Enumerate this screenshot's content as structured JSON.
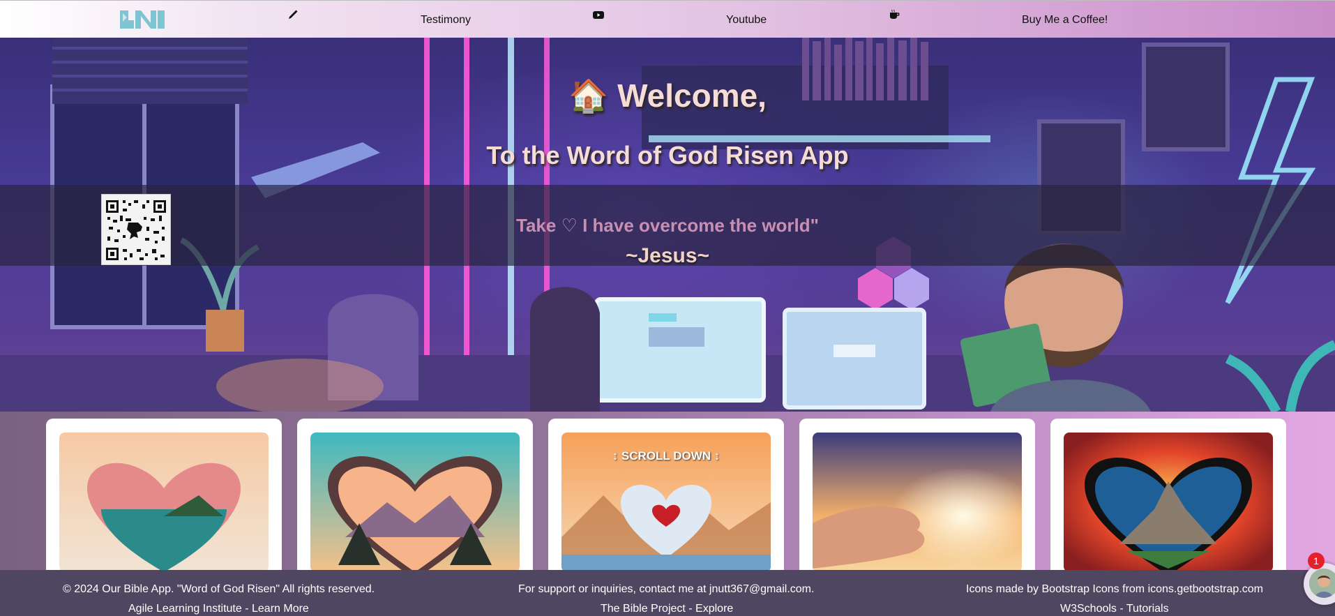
{
  "nav": {
    "logo_text": "JN",
    "items": [
      {
        "icon": "pen-icon",
        "label": ""
      },
      {
        "icon": "",
        "label": "Testimony"
      },
      {
        "icon": "youtube-icon",
        "label": ""
      },
      {
        "icon": "",
        "label": "Youtube"
      },
      {
        "icon": "coffee-cup-icon",
        "label": ""
      },
      {
        "icon": "",
        "label": "Buy Me a Coffee!"
      }
    ]
  },
  "hero": {
    "welcome": "🏠 Welcome,",
    "subtitle": "To the Word of God Risen App",
    "quote": "Take ♡ I have overcome the world\"",
    "attribution": "~Jesus~"
  },
  "cards": [
    {
      "image": "heart-lake-forest"
    },
    {
      "image": "heart-mountain-sunset"
    },
    {
      "image": "heart-scroll-down",
      "caption": "↕ SCROLL DOWN ↕"
    },
    {
      "image": "open-hand-sunrise"
    },
    {
      "image": "heart-mountain-fire"
    }
  ],
  "footer": {
    "copyright": "© 2024 Our Bible App. \"Word of God Risen\" All rights reserved.",
    "support": "For support or inquiries, contact me at jnutt367@gmail.com.",
    "icons_credit": "Icons made by Bootstrap Icons from icons.getbootstrap.com",
    "link1": "Agile Learning Institute - Learn More",
    "link2": "The Bible Project - Explore",
    "link3": "W3Schools - Tutorials"
  },
  "chat": {
    "badge_count": "1"
  },
  "colors": {
    "footer": "#4f4761",
    "badge": "#e4212b",
    "title": "#f6dcd6",
    "quote": "#c98fb3"
  }
}
